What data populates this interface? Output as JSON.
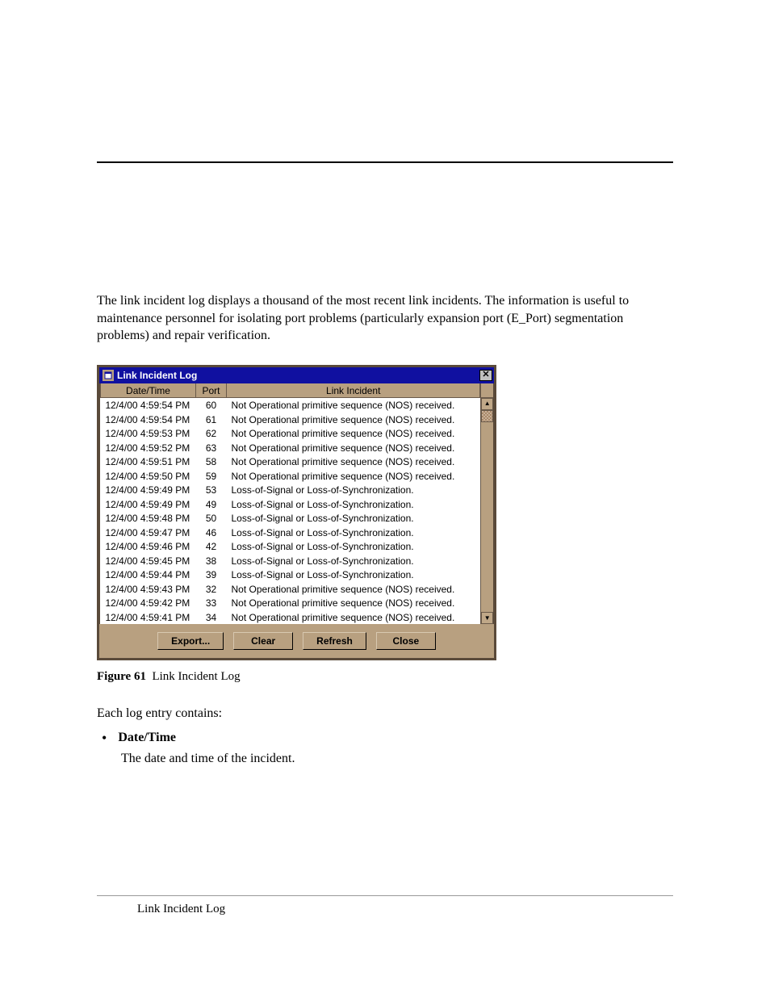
{
  "body_text": {
    "intro": "The link incident log displays a thousand of the most recent link incidents. The information is useful to maintenance personnel for isolating port problems (particularly expansion port (E_Port) segmentation problems) and repair verification.",
    "caption_label": "Figure 61",
    "caption_text": "Link Incident Log",
    "each_entry": "Each log entry contains:",
    "bullet1_title": "Date/Time",
    "bullet1_desc": "The date and time of the incident.",
    "footer": "Link Incident Log"
  },
  "dialog": {
    "title": "Link Incident Log",
    "columns": {
      "datetime": "Date/Time",
      "port": "Port",
      "incident": "Link Incident"
    },
    "buttons": {
      "export": "Export...",
      "clear": "Clear",
      "refresh": "Refresh",
      "close": "Close"
    },
    "rows": [
      {
        "dt": "12/4/00 4:59:54 PM",
        "port": "60",
        "inc": "Not Operational primitive sequence (NOS) received."
      },
      {
        "dt": "12/4/00 4:59:54 PM",
        "port": "61",
        "inc": "Not Operational primitive sequence (NOS) received."
      },
      {
        "dt": "12/4/00 4:59:53 PM",
        "port": "62",
        "inc": "Not Operational primitive sequence (NOS) received."
      },
      {
        "dt": "12/4/00 4:59:52 PM",
        "port": "63",
        "inc": "Not Operational primitive sequence (NOS) received."
      },
      {
        "dt": "12/4/00 4:59:51 PM",
        "port": "58",
        "inc": "Not Operational primitive sequence (NOS) received."
      },
      {
        "dt": "12/4/00 4:59:50 PM",
        "port": "59",
        "inc": "Not Operational primitive sequence (NOS) received."
      },
      {
        "dt": "12/4/00 4:59:49 PM",
        "port": "53",
        "inc": "Loss-of-Signal or Loss-of-Synchronization."
      },
      {
        "dt": "12/4/00 4:59:49 PM",
        "port": "49",
        "inc": "Loss-of-Signal or Loss-of-Synchronization."
      },
      {
        "dt": "12/4/00 4:59:48 PM",
        "port": "50",
        "inc": "Loss-of-Signal or Loss-of-Synchronization."
      },
      {
        "dt": "12/4/00 4:59:47 PM",
        "port": "46",
        "inc": "Loss-of-Signal or Loss-of-Synchronization."
      },
      {
        "dt": "12/4/00 4:59:46 PM",
        "port": "42",
        "inc": "Loss-of-Signal or Loss-of-Synchronization."
      },
      {
        "dt": "12/4/00 4:59:45 PM",
        "port": "38",
        "inc": "Loss-of-Signal or Loss-of-Synchronization."
      },
      {
        "dt": "12/4/00 4:59:44 PM",
        "port": "39",
        "inc": "Loss-of-Signal or Loss-of-Synchronization."
      },
      {
        "dt": "12/4/00 4:59:43 PM",
        "port": "32",
        "inc": "Not Operational primitive sequence (NOS) received."
      },
      {
        "dt": "12/4/00 4:59:42 PM",
        "port": "33",
        "inc": "Not Operational primitive sequence (NOS) received."
      },
      {
        "dt": "12/4/00 4:59:41 PM",
        "port": "34",
        "inc": "Not Operational primitive sequence (NOS) received."
      }
    ]
  }
}
